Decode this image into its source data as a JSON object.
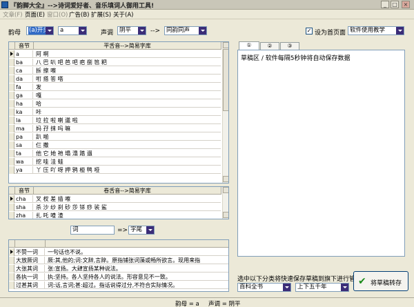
{
  "window": {
    "title": "『韵脚大全』-->诗词爱好者、音乐填词人御用工具!",
    "minimize": "_",
    "maximize": "□",
    "close": "×"
  },
  "menu": [
    {
      "label": "文章(F)",
      "disabled": true
    },
    {
      "label": "页面(E)",
      "disabled": false
    },
    {
      "label": "窗口(O)",
      "disabled": true
    },
    {
      "label": "广告(B)",
      "disabled": false
    },
    {
      "label": "扩展(S)",
      "disabled": false
    },
    {
      "label": "关于(A)",
      "disabled": false
    }
  ],
  "toolbar": {
    "yunmu_label": "韵母",
    "yunmu_mode": "(a)开头",
    "yunmu_value": "a",
    "shengdiao_label": "声调",
    "shengdiao_value": "阴平",
    "arrow": "-->",
    "tone_mode": "同韵同声",
    "homepage_check": "设为首页面",
    "homepage_checked": true,
    "homepage_select": "软件使用教学"
  },
  "grid1": {
    "col1": "音节",
    "col2": "平舌音-->简易字库",
    "rows": [
      {
        "syllable": "a",
        "chars": "阿 啊"
      },
      {
        "syllable": "ba",
        "chars": "八 巴 叭 吧 芭 吧 疤 捌 笆 粑"
      },
      {
        "syllable": "ca",
        "chars": "拆 擦 嚓"
      },
      {
        "syllable": "da",
        "chars": "咑 搭 答 嗒"
      },
      {
        "syllable": "fa",
        "chars": "发"
      },
      {
        "syllable": "ga",
        "chars": "嘎"
      },
      {
        "syllable": "ha",
        "chars": "哈"
      },
      {
        "syllable": "ka",
        "chars": "咔"
      },
      {
        "syllable": "la",
        "chars": "垃 拉 啦 喇 邋 啦"
      },
      {
        "syllable": "ma",
        "chars": "妈 孖 抹 吗 嘛"
      },
      {
        "syllable": "pa",
        "chars": "趴 啪"
      },
      {
        "syllable": "sa",
        "chars": "仨 撒"
      },
      {
        "syllable": "ta",
        "chars": "他 它 她 祂 塌 溻 踏 遢"
      },
      {
        "syllable": "wa",
        "chars": "挖 哇 洼 蛙"
      },
      {
        "syllable": "ya",
        "chars": "丫 压 吖 呀 押 鸦 桠 鸭 哑"
      }
    ]
  },
  "grid2": {
    "col1": "音节",
    "col2": "卷舌音-->简易字库",
    "rows": [
      {
        "syllable": "cha",
        "chars": "叉 杈 差 插 嚓"
      },
      {
        "syllable": "sha",
        "chars": "杀 沙 纱 刹 砂 莎 铩 痧 裟 鲨"
      },
      {
        "syllable": "zha",
        "chars": "扎 吒 喳 渣"
      }
    ]
  },
  "search": {
    "ci_value": "词",
    "arrow": "=>",
    "position": "字尾"
  },
  "grid3": {
    "rows": [
      {
        "word": "不赞一词",
        "meaning": "一句话也不说。"
      },
      {
        "word": "大放厥词",
        "meaning": "厥:其,他的;词:文辞,言辞。原指铺张词藻或畅所欲言。现用来指"
      },
      {
        "word": "大张其词",
        "meaning": "张:宣扬。大肆宣扬某种说法。"
      },
      {
        "word": "各执一词",
        "meaning": "执:坚持。各人坚持各人的说法。形容意见不一致。"
      },
      {
        "word": "过甚其词",
        "meaning": "词:话,言词;甚:超过。指话说得过分,不符合实际情况。"
      }
    ]
  },
  "tabs": [
    "①",
    "②",
    "③"
  ],
  "draft": {
    "text": "草稿区 / 软件每隔5秒钟将自动保存数据"
  },
  "save_panel": {
    "hint": "选中以下分类将快速保存草稿到旗下进行管理",
    "category1": "百科全书",
    "category2": "上下五千年",
    "save_label": "将草稿转存",
    "save_icon": "checkmark-icon"
  },
  "status": {
    "yunmu": "韵母 = a",
    "shengdiao": "声调 = 阴平"
  }
}
